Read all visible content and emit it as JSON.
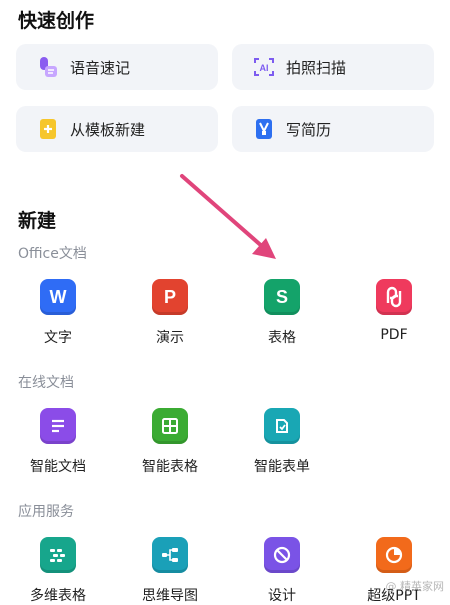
{
  "quick_create": {
    "title": "快速创作",
    "items": [
      {
        "label": "语音速记",
        "icon": "voice-memo-icon"
      },
      {
        "label": "拍照扫描",
        "icon": "ai-scan-icon"
      },
      {
        "label": "从模板新建",
        "icon": "template-icon"
      },
      {
        "label": "写简历",
        "icon": "resume-icon"
      }
    ]
  },
  "new": {
    "title": "新建",
    "office": {
      "label": "Office文档",
      "items": [
        {
          "label": "文字",
          "glyph": "W",
          "color": "#2f6cf5"
        },
        {
          "label": "演示",
          "glyph": "P",
          "color": "#e2432f"
        },
        {
          "label": "表格",
          "glyph": "S",
          "color": "#14a36a"
        },
        {
          "label": "PDF",
          "glyph": "",
          "color": "#ef3a5d"
        }
      ]
    },
    "online": {
      "label": "在线文档",
      "items": [
        {
          "label": "智能文档",
          "color": "#8b4ce8"
        },
        {
          "label": "智能表格",
          "color": "#3bab33"
        },
        {
          "label": "智能表单",
          "color": "#19a7b4"
        }
      ]
    },
    "services": {
      "label": "应用服务",
      "items": [
        {
          "label": "多维表格",
          "color": "#17a68c"
        },
        {
          "label": "思维导图",
          "color": "#1aa0b8"
        },
        {
          "label": "设计",
          "color": "#7a53e6"
        },
        {
          "label": "超级PPT",
          "color": "#f26a1b"
        }
      ]
    }
  },
  "annotation": {
    "arrow_color": "#e0457b"
  },
  "watermark": {
    "text": "@ 精英家网"
  }
}
